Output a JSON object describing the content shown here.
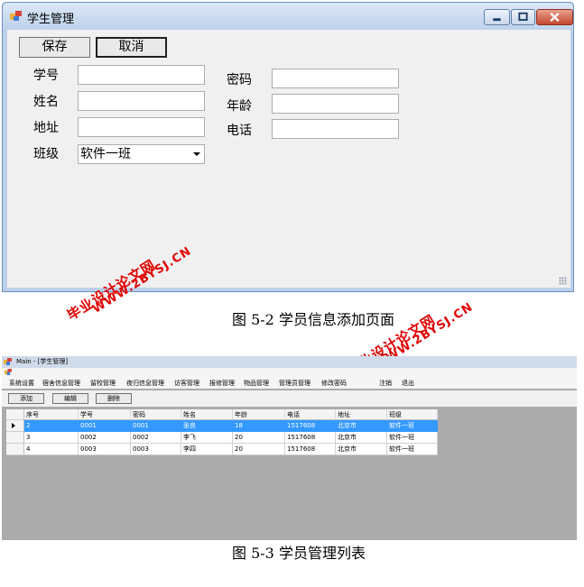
{
  "form1": {
    "title": "学生管理",
    "buttons": {
      "save": "保存",
      "cancel": "取消"
    },
    "labels": {
      "student_id": "学号",
      "password": "密码",
      "name": "姓名",
      "age": "年龄",
      "address": "地址",
      "phone": "电话",
      "class": "班级"
    },
    "fields": {
      "student_id": "",
      "password": "",
      "name": "",
      "age": "",
      "address": "",
      "phone": ""
    },
    "class_selected": "软件一班"
  },
  "caption1": "图 5-2 学员信息添加页面",
  "watermark": {
    "site_name": "毕业设计论文网",
    "url": "WWW.2BYSJ.CN",
    "color": "#e00000"
  },
  "form2": {
    "title": "Main - [学生管理]",
    "menu": [
      "系统设置",
      "宿舍信息管理",
      "留校管理",
      "夜归信息管理",
      "访客管理",
      "报修管理",
      "物品管理",
      "管理员管理",
      "修改密码",
      "注销",
      "退出"
    ],
    "toolbar": {
      "add": "添加",
      "edit": "编辑",
      "delete": "删除"
    },
    "table": {
      "headers": [
        "序号",
        "学号",
        "密码",
        "姓名",
        "年龄",
        "电话",
        "地址",
        "班级"
      ],
      "rows": [
        [
          "2",
          "0001",
          "0001",
          "张良",
          "18",
          "1517608",
          "北京市",
          "软件一班"
        ],
        [
          "3",
          "0002",
          "0002",
          "李飞",
          "20",
          "1517608",
          "北京市",
          "软件一班"
        ],
        [
          "4",
          "0003",
          "0003",
          "李四",
          "20",
          "1517608",
          "北京市",
          "软件一班"
        ]
      ],
      "selected_row": 0
    }
  },
  "caption2": "图 5-3 学员管理列表",
  "colors": {
    "selection": "#3399ff",
    "mdi_background": "#ababab",
    "window_frame": "#bcd0ea"
  }
}
